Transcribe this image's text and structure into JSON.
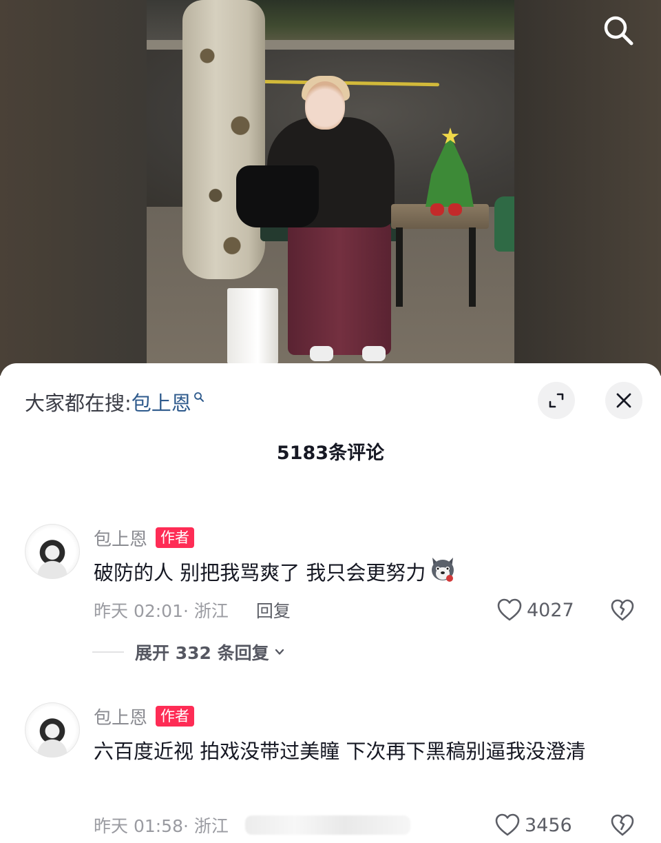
{
  "top_bar": {
    "search_icon": "search-icon"
  },
  "sheet": {
    "trending": {
      "prefix": "大家都在搜:",
      "keyword": "包上恩",
      "keyword_icon": "search-icon"
    },
    "expand_icon": "expand-icon",
    "close_icon": "close-icon",
    "comment_count": "5183条评论"
  },
  "comments": [
    {
      "author": "包上恩",
      "badge": "作者",
      "text": "破防的人 别把我骂爽了 我只会更努力",
      "emoji": "wolf-emoji",
      "meta": "昨天 02:01· 浙江",
      "reply_label": "回复",
      "likes": "4027",
      "expand_label": "展开 332 条回复"
    },
    {
      "author": "包上恩",
      "badge": "作者",
      "text": "六百度近视 拍戏没带过美瞳 下次再下黑稿别逼我没澄清",
      "meta": "昨天 01:58· 浙江",
      "likes": "3456"
    }
  ],
  "colors": {
    "accent": "#fe2c55",
    "keyword": "#2e5a8c",
    "text": "#161823",
    "muted": "#9a9ba1"
  }
}
